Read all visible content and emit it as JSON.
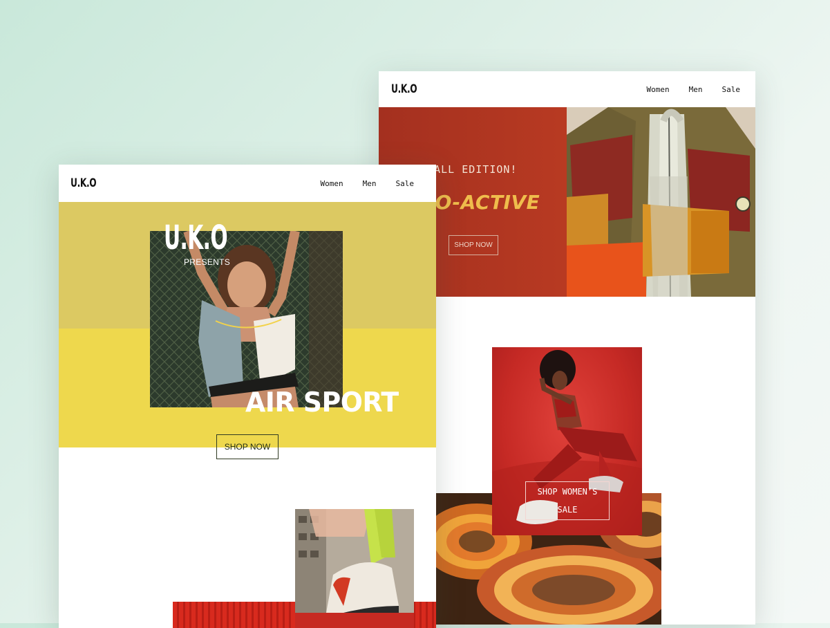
{
  "back_page": {
    "logo": "U.K.O",
    "nav": [
      "Women",
      "Men",
      "Sale"
    ],
    "hero": {
      "edition": "W FALL EDITION!",
      "title": "TRO-ACTIVE",
      "cta": "SHOP NOW"
    },
    "promo": {
      "cta_line1": "SHOP WOMEN’S",
      "cta_line2": "SALE"
    }
  },
  "front_page": {
    "logo": "U.K.O",
    "nav": [
      "Women",
      "Men",
      "Sale"
    ],
    "hero": {
      "brand": "U.K.O",
      "presents": "PRESENTS",
      "title": "AIR SPORT",
      "cta": "SHOP NOW"
    }
  },
  "colors": {
    "back_hero": "#a4301f",
    "retro_text": "#efbd4c",
    "front_hero_top": "#dcc962",
    "front_hero_bottom": "#eed84d",
    "promo_red": "#c62a25"
  }
}
